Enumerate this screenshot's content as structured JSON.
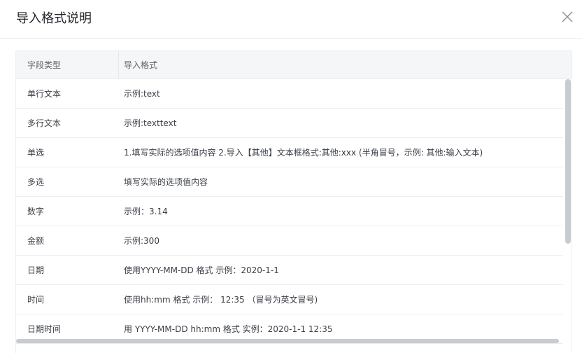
{
  "dialog": {
    "title": "导入格式说明",
    "close_icon": "close-icon"
  },
  "table": {
    "headers": [
      "字段类型",
      "导入格式"
    ],
    "rows": [
      {
        "type": "单行文本",
        "format": "示例:text"
      },
      {
        "type": "多行文本",
        "format": "示例:texttext"
      },
      {
        "type": "单选",
        "format": "1.填写实际的选项值内容 2.导入【其他】文本框格式:其他:xxx (半角冒号，示例: 其他:输入文本)"
      },
      {
        "type": "多选",
        "format": "填写实际的选项值内容"
      },
      {
        "type": "数字",
        "format": "示例：3.14"
      },
      {
        "type": "金额",
        "format": "示例:300"
      },
      {
        "type": "日期",
        "format": "使用YYYY-MM-DD 格式 示例：2020-1-1"
      },
      {
        "type": "时间",
        "format": "使用hh:mm 格式 示例： 12:35 （冒号为英文冒号)"
      },
      {
        "type": "日期时间",
        "format": "用 YYYY-MM-DD hh:mm 格式 实例：2020-1-1 12:35"
      }
    ]
  }
}
